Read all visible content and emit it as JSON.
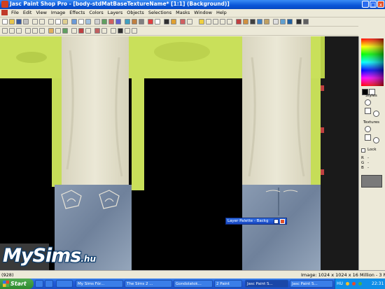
{
  "window": {
    "title": "Jasc Paint Shop Pro - [body-stdMatBaseTextureName*   [1:1] (Background)]",
    "min_label": "_",
    "max_label": "□",
    "close_label": "x"
  },
  "menu": [
    "File",
    "Edit",
    "View",
    "Image",
    "Effects",
    "Colors",
    "Layers",
    "Objects",
    "Selections",
    "Masks",
    "Window",
    "Help"
  ],
  "panel": {
    "styles_label": "Styles",
    "textures_label": "Textures",
    "lock_label": "Lock",
    "r_label": "R",
    "g_label": "G",
    "b_label": "B",
    "r_value": "-",
    "g_value": "-",
    "b_value": "-"
  },
  "layer_palette": {
    "title": "Layer Palette - Backg"
  },
  "status": {
    "left": "(928)",
    "right": "Image: 1024 x 1024 x 16 Million - 3 MBytes"
  },
  "taskbar": {
    "start_label": "Start",
    "tasks": [
      {
        "label": "My Sims Fór..."
      },
      {
        "label": "The Sims 2 ..."
      },
      {
        "label": "Gondolatok..."
      },
      {
        "label": "2 Paint"
      },
      {
        "label": "Jasc Paint S..."
      },
      {
        "label": "Jasc Paint S..."
      }
    ],
    "lang": "HU",
    "clock": "22:31"
  },
  "watermark": {
    "text": "MySims",
    "tld": ".hu"
  },
  "colors": {
    "title_blue": "#0a56d8",
    "skin_green": "#c9e05a",
    "cloth_cream": "#e6e3d0",
    "denim": "#7d8fa8",
    "foreground_swatch": "#000000",
    "background_swatch": "#ffffff"
  },
  "icons": {
    "toolbar_row1": [
      "new-icon",
      "open-icon",
      "save-icon",
      "print-icon",
      "undo-icon",
      "redo-icon",
      "cut-icon",
      "copy-icon",
      "paste-icon",
      "browse-icon",
      "zoom-icon",
      "layer-icon",
      "tool-icon"
    ],
    "toolbar_row2": [
      "select-icon",
      "lasso-icon",
      "magic-wand-icon",
      "move-icon",
      "crop-icon",
      "brush-icon",
      "eraser-icon",
      "fill-icon",
      "text-icon",
      "shape-icon"
    ]
  }
}
